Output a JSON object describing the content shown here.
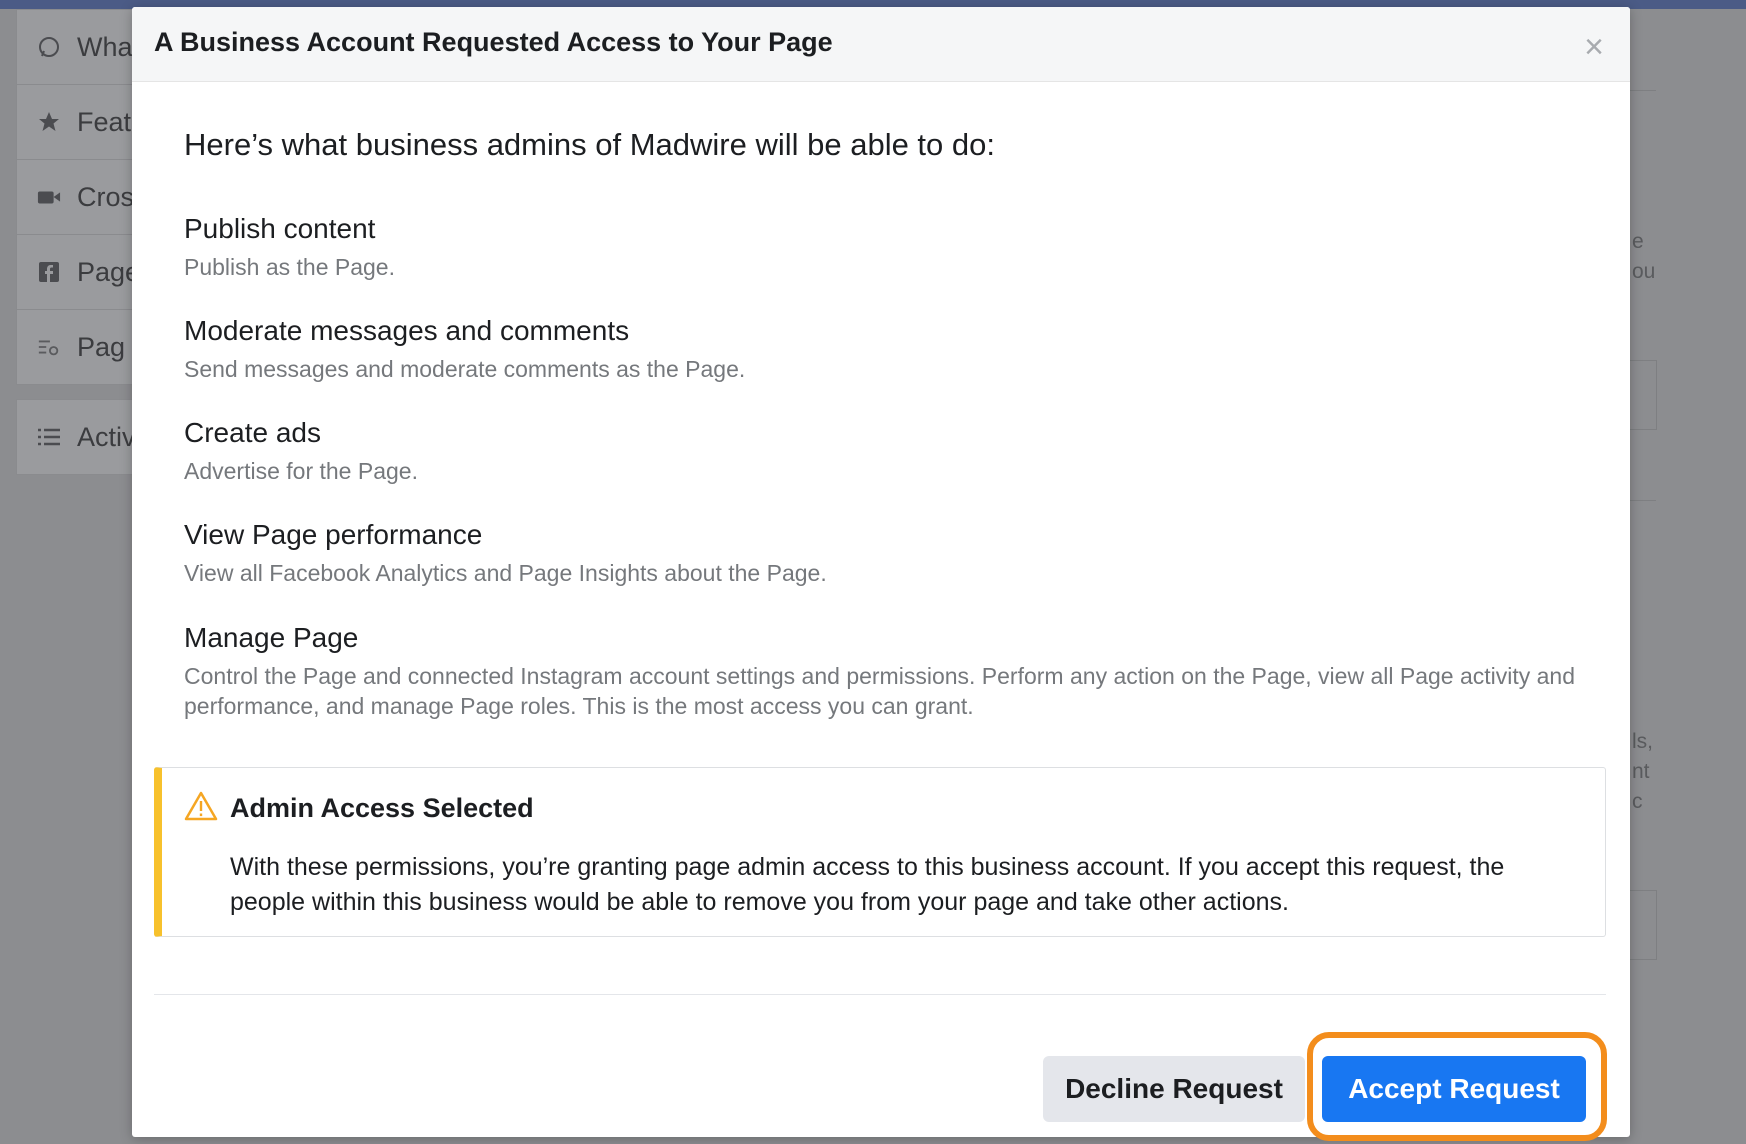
{
  "background": {
    "sidebar_items": [
      {
        "label": "Wha",
        "icon": "whatsapp-icon"
      },
      {
        "label": "Feat",
        "icon": "star-icon"
      },
      {
        "label": "Cros",
        "icon": "video-camera-icon"
      },
      {
        "label": "Page",
        "icon": "facebook-page-icon"
      },
      {
        "label": "Pag",
        "icon": "page-settings-icon"
      }
    ],
    "sidebar_items_2": [
      {
        "label": "Activ",
        "icon": "list-icon"
      }
    ],
    "right_fragments": [
      "e",
      "ou",
      "ls,",
      "nt",
      "c"
    ]
  },
  "modal": {
    "title": "A Business Account Requested Access to Your Page",
    "close_glyph": "×",
    "intro": "Here’s what business admins of Madwire will be able to do:",
    "permissions": [
      {
        "title": "Publish content",
        "description": "Publish as the Page."
      },
      {
        "title": "Moderate messages and comments",
        "description": "Send messages and moderate comments as the Page."
      },
      {
        "title": "Create ads",
        "description": "Advertise for the Page."
      },
      {
        "title": "View Page performance",
        "description": "View all Facebook Analytics and Page Insights about the Page."
      },
      {
        "title": "Manage Page",
        "description": "Control the Page and connected Instagram account settings and permissions. Perform any action on the Page, view all Page activity and performance, and manage Page roles. This is the most access you can grant."
      }
    ],
    "warning": {
      "icon": "warning-triangle-icon",
      "title": "Admin Access Selected",
      "body": "With these permissions, you’re granting page admin access to this business account. If you accept this request, the people within this business would be able to remove you from your page and take other actions."
    },
    "buttons": {
      "decline": "Decline Request",
      "accept": "Accept Request"
    }
  },
  "colors": {
    "accent": "#1877f2",
    "warning": "#f7c12c",
    "highlight_ring": "#f38d1c",
    "topbar": "#4b5b86"
  }
}
